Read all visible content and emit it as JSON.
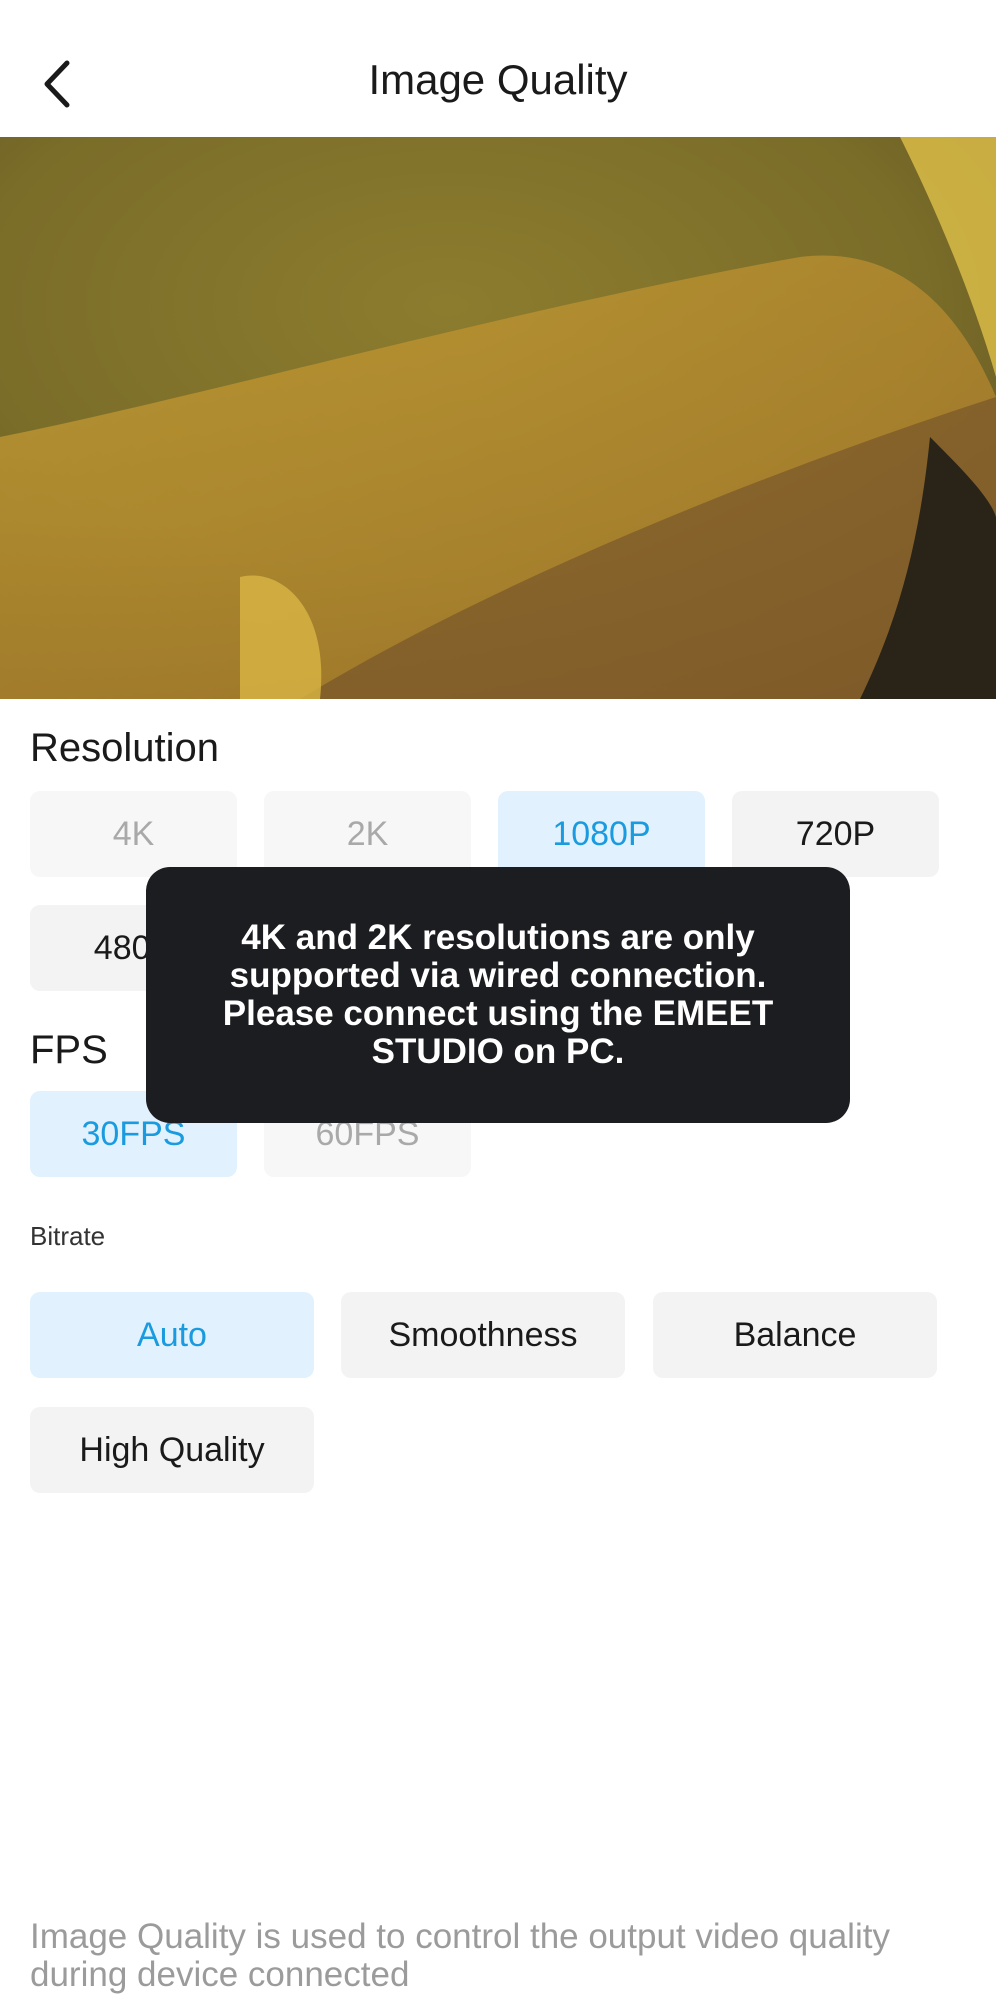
{
  "header": {
    "title": "Image Quality",
    "back_icon": "chevron-left-icon"
  },
  "preview": {
    "description_icon": "camera-preview"
  },
  "resolution": {
    "title": "Resolution",
    "options": [
      {
        "label": "4K",
        "state": "disabled"
      },
      {
        "label": "2K",
        "state": "disabled"
      },
      {
        "label": "1080P",
        "state": "selected"
      },
      {
        "label": "720P",
        "state": "normal"
      },
      {
        "label": "480P",
        "state": "normal"
      }
    ]
  },
  "fps": {
    "title": "FPS",
    "options": [
      {
        "label": "30FPS",
        "state": "selected"
      },
      {
        "label": "60FPS",
        "state": "disabled"
      }
    ]
  },
  "bitrate": {
    "title": "Bitrate",
    "options": [
      {
        "label": "Auto",
        "state": "selected"
      },
      {
        "label": "Smoothness",
        "state": "normal"
      },
      {
        "label": "Balance",
        "state": "normal"
      },
      {
        "label": "High Quality",
        "state": "normal"
      }
    ]
  },
  "toast": {
    "message": "4K and 2K resolutions are only supported via wired connection. Please connect using the EMEET STUDIO on PC."
  },
  "footer": {
    "note": "Image Quality is used to control the output video quality during device connected"
  },
  "colors": {
    "accent": "#1a9be0",
    "selected_bg": "#e1f1fd",
    "chip_bg": "#f3f3f3",
    "toast_bg": "#1c1d20"
  }
}
